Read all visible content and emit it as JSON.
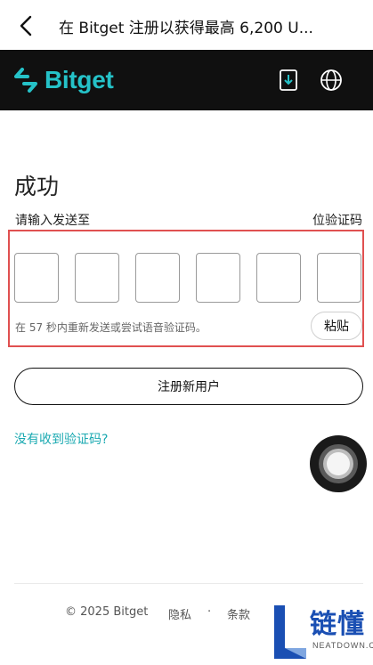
{
  "topbar": {
    "title": "在 Bitget 注册以获得最高 6,200 U...",
    "back_icon": "chevron-left-icon"
  },
  "brand": {
    "logo_text": "Bitget",
    "accent": "#25c2c8",
    "download_icon": "download-icon",
    "language_icon": "globe-icon"
  },
  "main": {
    "heading": "成功",
    "subline_left": "请输入发送至",
    "subline_right": "位验证码",
    "otp_count": 6,
    "resend_text": "在 57 秒内重新发送或尝试语音验证码。",
    "paste_label": "粘贴",
    "register_label": "注册新用户",
    "no_code_link": "没有收到验证码?",
    "link_color": "#1aa9b1",
    "highlight_color": "#e05050"
  },
  "footer": {
    "copyright": "© 2025 Bitget",
    "privacy": "隐私",
    "separator": "·",
    "terms": "条款"
  },
  "watermark": {
    "text": "链懂",
    "sub": "NEATDOWN.COM"
  }
}
